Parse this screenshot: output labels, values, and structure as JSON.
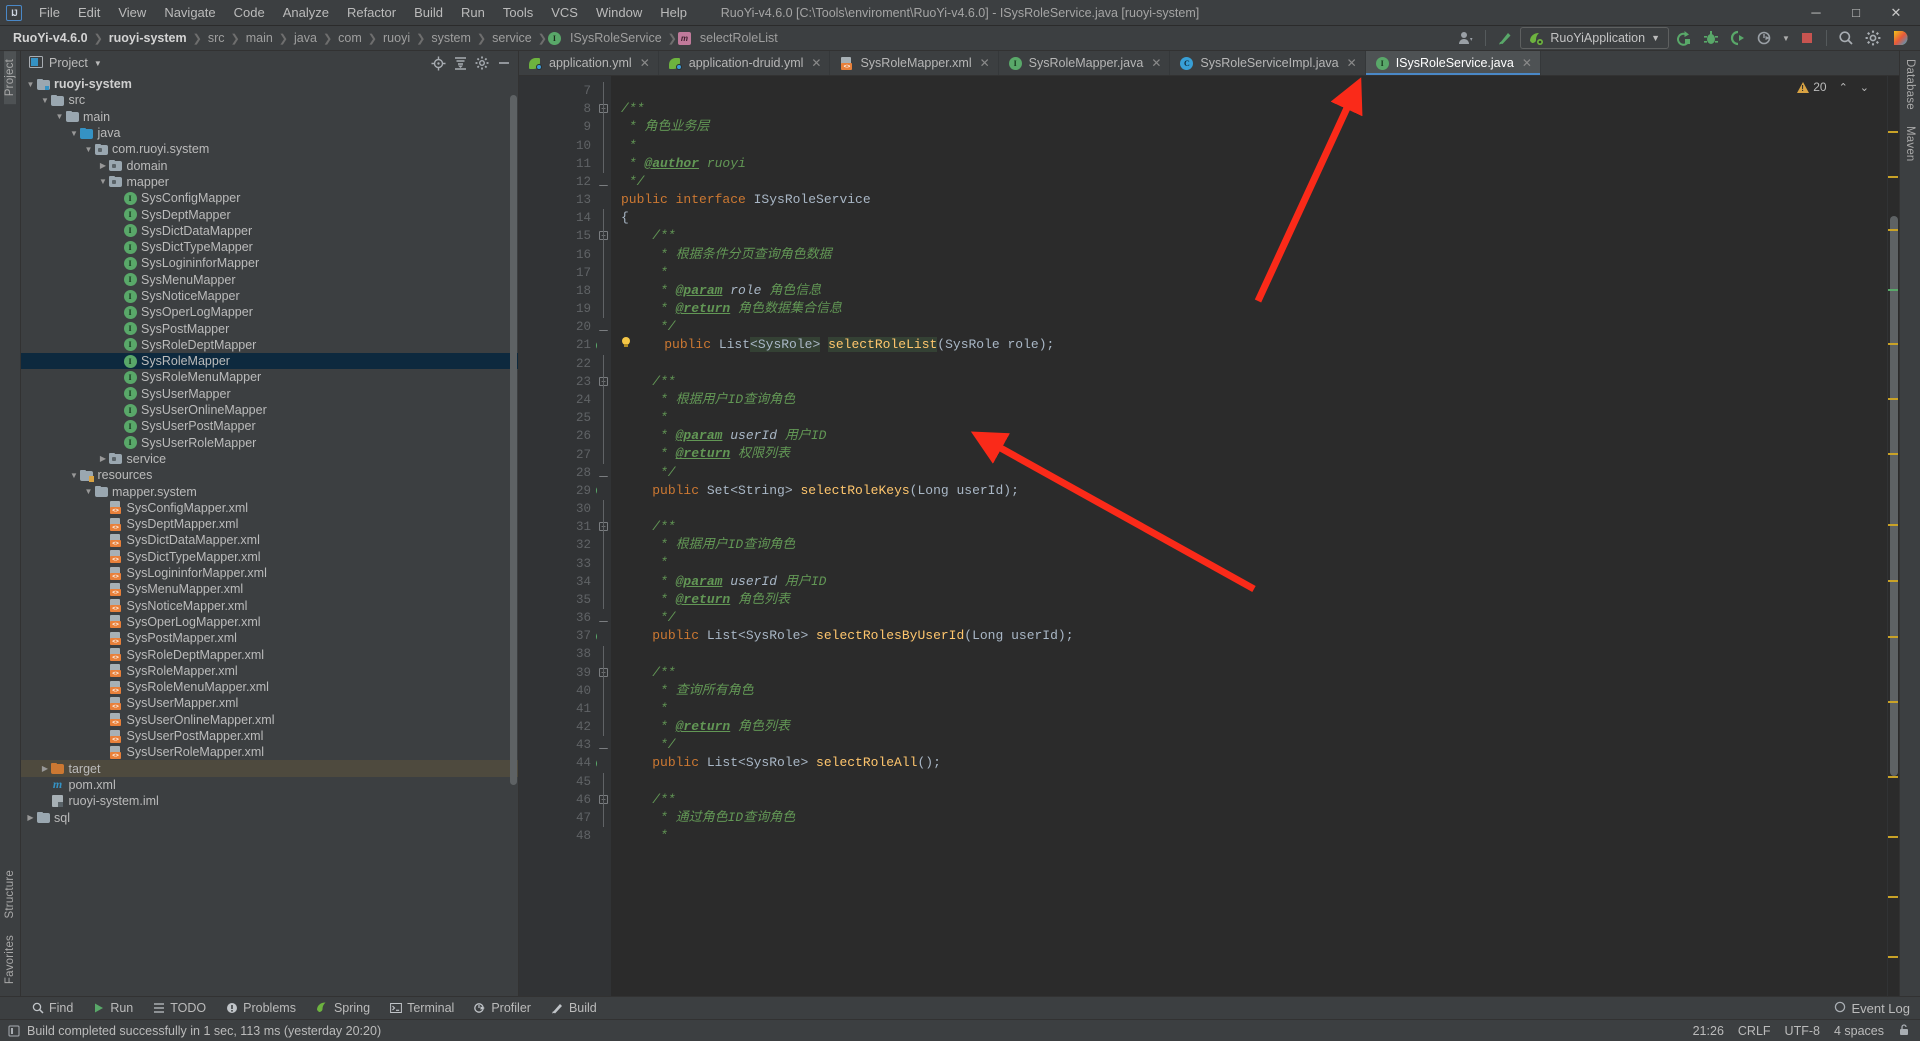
{
  "window": {
    "title": "RuoYi-v4.6.0 [C:\\Tools\\enviroment\\RuoYi-v4.6.0] - ISysRoleService.java [ruoyi-system]",
    "minimize": "─",
    "maximize": "□",
    "close": "✕"
  },
  "menu": [
    {
      "label": "File"
    },
    {
      "label": "Edit"
    },
    {
      "label": "View"
    },
    {
      "label": "Navigate"
    },
    {
      "label": "Code"
    },
    {
      "label": "Analyze"
    },
    {
      "label": "Refactor"
    },
    {
      "label": "Build"
    },
    {
      "label": "Run"
    },
    {
      "label": "Tools"
    },
    {
      "label": "VCS"
    },
    {
      "label": "Window"
    },
    {
      "label": "Help"
    }
  ],
  "breadcrumb": [
    {
      "label": "RuoYi-v4.6.0",
      "bold": true,
      "icon": null
    },
    {
      "label": "ruoyi-system",
      "bold": true,
      "icon": null
    },
    {
      "label": "src",
      "bold": false,
      "icon": null
    },
    {
      "label": "main",
      "bold": false,
      "icon": null
    },
    {
      "label": "java",
      "bold": false,
      "icon": null
    },
    {
      "label": "com",
      "bold": false,
      "icon": null
    },
    {
      "label": "ruoyi",
      "bold": false,
      "icon": null
    },
    {
      "label": "system",
      "bold": false,
      "icon": null
    },
    {
      "label": "service",
      "bold": false,
      "icon": null
    },
    {
      "label": "ISysRoleService",
      "bold": false,
      "icon": "interface-icon"
    },
    {
      "label": "selectRoleList",
      "bold": false,
      "icon": "method-icon"
    }
  ],
  "toolbar": {
    "run_config": "RuoYiApplication",
    "icons": [
      "user-icon",
      "vcs-update-icon",
      "run-icon",
      "debug-icon",
      "run-coverage-icon",
      "profiler-icon",
      "stop-icon",
      "search-everywhere-icon",
      "settings-icon",
      "ide-help-icon"
    ]
  },
  "project_panel": {
    "title": "Project",
    "actions": [
      "locate-icon",
      "collapse-all-icon",
      "settings-icon",
      "hide-icon"
    ],
    "tree": [
      {
        "depth": 1,
        "label": "ruoyi-system",
        "icon": "module-folder",
        "arrow": "down",
        "bold": true
      },
      {
        "depth": 2,
        "label": "src",
        "icon": "folder",
        "arrow": "down"
      },
      {
        "depth": 3,
        "label": "main",
        "icon": "folder",
        "arrow": "down"
      },
      {
        "depth": 4,
        "label": "java",
        "icon": "source-folder",
        "arrow": "down"
      },
      {
        "depth": 5,
        "label": "com.ruoyi.system",
        "icon": "package",
        "arrow": "down"
      },
      {
        "depth": 6,
        "label": "domain",
        "icon": "package",
        "arrow": "right"
      },
      {
        "depth": 6,
        "label": "mapper",
        "icon": "package",
        "arrow": "down"
      },
      {
        "depth": 7,
        "label": "SysConfigMapper",
        "icon": "interface"
      },
      {
        "depth": 7,
        "label": "SysDeptMapper",
        "icon": "interface"
      },
      {
        "depth": 7,
        "label": "SysDictDataMapper",
        "icon": "interface"
      },
      {
        "depth": 7,
        "label": "SysDictTypeMapper",
        "icon": "interface"
      },
      {
        "depth": 7,
        "label": "SysLogininforMapper",
        "icon": "interface"
      },
      {
        "depth": 7,
        "label": "SysMenuMapper",
        "icon": "interface"
      },
      {
        "depth": 7,
        "label": "SysNoticeMapper",
        "icon": "interface"
      },
      {
        "depth": 7,
        "label": "SysOperLogMapper",
        "icon": "interface"
      },
      {
        "depth": 7,
        "label": "SysPostMapper",
        "icon": "interface"
      },
      {
        "depth": 7,
        "label": "SysRoleDeptMapper",
        "icon": "interface"
      },
      {
        "depth": 7,
        "label": "SysRoleMapper",
        "icon": "interface",
        "selected": true
      },
      {
        "depth": 7,
        "label": "SysRoleMenuMapper",
        "icon": "interface"
      },
      {
        "depth": 7,
        "label": "SysUserMapper",
        "icon": "interface"
      },
      {
        "depth": 7,
        "label": "SysUserOnlineMapper",
        "icon": "interface"
      },
      {
        "depth": 7,
        "label": "SysUserPostMapper",
        "icon": "interface"
      },
      {
        "depth": 7,
        "label": "SysUserRoleMapper",
        "icon": "interface"
      },
      {
        "depth": 6,
        "label": "service",
        "icon": "package",
        "arrow": "right"
      },
      {
        "depth": 4,
        "label": "resources",
        "icon": "resource-folder",
        "arrow": "down"
      },
      {
        "depth": 5,
        "label": "mapper.system",
        "icon": "folder",
        "arrow": "down"
      },
      {
        "depth": 6,
        "label": "SysConfigMapper.xml",
        "icon": "xml"
      },
      {
        "depth": 6,
        "label": "SysDeptMapper.xml",
        "icon": "xml"
      },
      {
        "depth": 6,
        "label": "SysDictDataMapper.xml",
        "icon": "xml"
      },
      {
        "depth": 6,
        "label": "SysDictTypeMapper.xml",
        "icon": "xml"
      },
      {
        "depth": 6,
        "label": "SysLogininforMapper.xml",
        "icon": "xml"
      },
      {
        "depth": 6,
        "label": "SysMenuMapper.xml",
        "icon": "xml"
      },
      {
        "depth": 6,
        "label": "SysNoticeMapper.xml",
        "icon": "xml"
      },
      {
        "depth": 6,
        "label": "SysOperLogMapper.xml",
        "icon": "xml"
      },
      {
        "depth": 6,
        "label": "SysPostMapper.xml",
        "icon": "xml"
      },
      {
        "depth": 6,
        "label": "SysRoleDeptMapper.xml",
        "icon": "xml"
      },
      {
        "depth": 6,
        "label": "SysRoleMapper.xml",
        "icon": "xml"
      },
      {
        "depth": 6,
        "label": "SysRoleMenuMapper.xml",
        "icon": "xml"
      },
      {
        "depth": 6,
        "label": "SysUserMapper.xml",
        "icon": "xml"
      },
      {
        "depth": 6,
        "label": "SysUserOnlineMapper.xml",
        "icon": "xml"
      },
      {
        "depth": 6,
        "label": "SysUserPostMapper.xml",
        "icon": "xml"
      },
      {
        "depth": 6,
        "label": "SysUserRoleMapper.xml",
        "icon": "xml"
      },
      {
        "depth": 2,
        "label": "target",
        "icon": "target-folder",
        "arrow": "right",
        "dimselected": true
      },
      {
        "depth": 2,
        "label": "pom.xml",
        "icon": "maven"
      },
      {
        "depth": 2,
        "label": "ruoyi-system.iml",
        "icon": "iml"
      },
      {
        "depth": 1,
        "label": "sql",
        "icon": "folder",
        "arrow": "right"
      }
    ]
  },
  "left_rail": {
    "top": [
      {
        "label": "Project",
        "active": true
      }
    ],
    "bottom": [
      {
        "label": "Structure"
      },
      {
        "label": "Favorites"
      }
    ]
  },
  "right_rail": [
    {
      "label": "Database"
    },
    {
      "label": "Maven"
    }
  ],
  "tabs": [
    {
      "label": "application.yml",
      "icon": "yml",
      "active": false
    },
    {
      "label": "application-druid.yml",
      "icon": "yml",
      "active": false
    },
    {
      "label": "SysRoleMapper.xml",
      "icon": "xml",
      "active": false
    },
    {
      "label": "SysRoleMapper.java",
      "icon": "interface",
      "active": false
    },
    {
      "label": "SysRoleServiceImpl.java",
      "icon": "class",
      "active": false
    },
    {
      "label": "ISysRoleService.java",
      "icon": "interface",
      "active": true
    }
  ],
  "editor": {
    "first_line": 7,
    "inspection_count": "20",
    "lines": [
      {
        "n": 7,
        "segs": []
      },
      {
        "n": 8,
        "fold": "minus",
        "segs": [
          {
            "t": "/**",
            "c": "cmt"
          }
        ]
      },
      {
        "n": 9,
        "segs": [
          {
            "t": " * 角色业务层",
            "c": "cmt"
          }
        ]
      },
      {
        "n": 10,
        "segs": [
          {
            "t": " *",
            "c": "cmt"
          }
        ]
      },
      {
        "n": 11,
        "segs": [
          {
            "t": " * ",
            "c": "cmt"
          },
          {
            "t": "@author",
            "c": "tag-jd"
          },
          {
            "t": " ruoyi",
            "c": "cmt"
          }
        ]
      },
      {
        "n": 12,
        "fold": "end",
        "segs": [
          {
            "t": " */",
            "c": "cmt"
          }
        ]
      },
      {
        "n": 13,
        "gutter": [
          "bean-icon",
          "impl-icon"
        ],
        "segs": [
          {
            "t": "public interface ",
            "c": "kw"
          },
          {
            "t": "ISysRoleService",
            "c": "plain"
          }
        ]
      },
      {
        "n": 14,
        "segs": [
          {
            "t": "{",
            "c": "plain"
          }
        ]
      },
      {
        "n": 15,
        "fold": "minus",
        "segs": [
          {
            "t": "    /**",
            "c": "cmt"
          }
        ]
      },
      {
        "n": 16,
        "segs": [
          {
            "t": "     * 根据条件分页查询角色数据",
            "c": "cmt"
          }
        ]
      },
      {
        "n": 17,
        "segs": [
          {
            "t": "     *",
            "c": "cmt"
          }
        ]
      },
      {
        "n": 18,
        "segs": [
          {
            "t": "     * ",
            "c": "cmt"
          },
          {
            "t": "@param",
            "c": "tag-jd"
          },
          {
            "t": " role",
            "c": "jd-param"
          },
          {
            "t": " 角色信息",
            "c": "cmt"
          }
        ]
      },
      {
        "n": 19,
        "segs": [
          {
            "t": "     * ",
            "c": "cmt"
          },
          {
            "t": "@return",
            "c": "tag-jd"
          },
          {
            "t": " 角色数据集合信息",
            "c": "cmt"
          }
        ]
      },
      {
        "n": 20,
        "fold": "end",
        "segs": [
          {
            "t": "     */",
            "c": "cmt"
          }
        ]
      },
      {
        "n": 21,
        "gutter": [
          "impl-icon"
        ],
        "bulb": true,
        "segs": [
          {
            "t": "    ",
            "c": "plain"
          },
          {
            "t": "public ",
            "c": "kw"
          },
          {
            "t": "List",
            "c": "plain"
          },
          {
            "t": "<SysRole>",
            "c": "plain hl"
          },
          {
            "t": " ",
            "c": "plain"
          },
          {
            "t": "selectRoleList",
            "c": "mth hl"
          },
          {
            "t": "(SysRole role);",
            "c": "plain"
          }
        ]
      },
      {
        "n": 22,
        "segs": []
      },
      {
        "n": 23,
        "fold": "minus",
        "segs": [
          {
            "t": "    /**",
            "c": "cmt"
          }
        ]
      },
      {
        "n": 24,
        "segs": [
          {
            "t": "     * 根据用户ID查询角色",
            "c": "cmt"
          }
        ]
      },
      {
        "n": 25,
        "segs": [
          {
            "t": "     *",
            "c": "cmt"
          }
        ]
      },
      {
        "n": 26,
        "segs": [
          {
            "t": "     * ",
            "c": "cmt"
          },
          {
            "t": "@param",
            "c": "tag-jd"
          },
          {
            "t": " userId",
            "c": "jd-param"
          },
          {
            "t": " 用户ID",
            "c": "cmt"
          }
        ]
      },
      {
        "n": 27,
        "segs": [
          {
            "t": "     * ",
            "c": "cmt"
          },
          {
            "t": "@return",
            "c": "tag-jd"
          },
          {
            "t": " 权限列表",
            "c": "cmt"
          }
        ]
      },
      {
        "n": 28,
        "fold": "end",
        "segs": [
          {
            "t": "     */",
            "c": "cmt"
          }
        ]
      },
      {
        "n": 29,
        "gutter": [
          "impl-icon"
        ],
        "segs": [
          {
            "t": "    ",
            "c": "plain"
          },
          {
            "t": "public ",
            "c": "kw"
          },
          {
            "t": "Set<String> ",
            "c": "plain"
          },
          {
            "t": "selectRoleKeys",
            "c": "mth"
          },
          {
            "t": "(Long userId);",
            "c": "plain"
          }
        ]
      },
      {
        "n": 30,
        "segs": []
      },
      {
        "n": 31,
        "fold": "minus",
        "segs": [
          {
            "t": "    /**",
            "c": "cmt"
          }
        ]
      },
      {
        "n": 32,
        "segs": [
          {
            "t": "     * 根据用户ID查询角色",
            "c": "cmt"
          }
        ]
      },
      {
        "n": 33,
        "segs": [
          {
            "t": "     *",
            "c": "cmt"
          }
        ]
      },
      {
        "n": 34,
        "segs": [
          {
            "t": "     * ",
            "c": "cmt"
          },
          {
            "t": "@param",
            "c": "tag-jd"
          },
          {
            "t": " userId",
            "c": "jd-param"
          },
          {
            "t": " 用户ID",
            "c": "cmt"
          }
        ]
      },
      {
        "n": 35,
        "segs": [
          {
            "t": "     * ",
            "c": "cmt"
          },
          {
            "t": "@return",
            "c": "tag-jd"
          },
          {
            "t": " 角色列表",
            "c": "cmt"
          }
        ]
      },
      {
        "n": 36,
        "fold": "end",
        "segs": [
          {
            "t": "     */",
            "c": "cmt"
          }
        ]
      },
      {
        "n": 37,
        "gutter": [
          "impl-icon"
        ],
        "segs": [
          {
            "t": "    ",
            "c": "plain"
          },
          {
            "t": "public ",
            "c": "kw"
          },
          {
            "t": "List<SysRole> ",
            "c": "plain"
          },
          {
            "t": "selectRolesByUserId",
            "c": "mth"
          },
          {
            "t": "(Long userId);",
            "c": "plain"
          }
        ]
      },
      {
        "n": 38,
        "segs": []
      },
      {
        "n": 39,
        "fold": "minus",
        "segs": [
          {
            "t": "    /**",
            "c": "cmt"
          }
        ]
      },
      {
        "n": 40,
        "segs": [
          {
            "t": "     * 查询所有角色",
            "c": "cmt"
          }
        ]
      },
      {
        "n": 41,
        "segs": [
          {
            "t": "     *",
            "c": "cmt"
          }
        ]
      },
      {
        "n": 42,
        "segs": [
          {
            "t": "     * ",
            "c": "cmt"
          },
          {
            "t": "@return",
            "c": "tag-jd"
          },
          {
            "t": " 角色列表",
            "c": "cmt"
          }
        ]
      },
      {
        "n": 43,
        "fold": "end",
        "segs": [
          {
            "t": "     */",
            "c": "cmt"
          }
        ]
      },
      {
        "n": 44,
        "gutter": [
          "impl-icon"
        ],
        "segs": [
          {
            "t": "    ",
            "c": "plain"
          },
          {
            "t": "public ",
            "c": "kw"
          },
          {
            "t": "List<SysRole> ",
            "c": "plain"
          },
          {
            "t": "selectRoleAll",
            "c": "mth"
          },
          {
            "t": "();",
            "c": "plain"
          }
        ]
      },
      {
        "n": 45,
        "segs": []
      },
      {
        "n": 46,
        "fold": "minus",
        "segs": [
          {
            "t": "    /**",
            "c": "cmt"
          }
        ]
      },
      {
        "n": 47,
        "segs": [
          {
            "t": "     * 通过角色ID查询角色",
            "c": "cmt"
          }
        ]
      },
      {
        "n": 48,
        "segs": [
          {
            "t": "     *",
            "c": "cmt"
          }
        ]
      }
    ]
  },
  "tool_windows": [
    {
      "label": "Find",
      "icon": "search-icon"
    },
    {
      "label": "Run",
      "icon": "run-icon"
    },
    {
      "label": "TODO",
      "icon": "todo-icon"
    },
    {
      "label": "Problems",
      "icon": "problems-icon"
    },
    {
      "label": "Spring",
      "icon": "spring-icon"
    },
    {
      "label": "Terminal",
      "icon": "terminal-icon"
    },
    {
      "label": "Profiler",
      "icon": "profiler-icon"
    },
    {
      "label": "Build",
      "icon": "build-icon"
    }
  ],
  "event_log": "Event Log",
  "status": {
    "message": "Build completed successfully in 1 sec, 113 ms (yesterday 20:20)",
    "time": "21:26",
    "line_sep": "CRLF",
    "encoding": "UTF-8",
    "indent": "4 spaces",
    "lock": "lock-icon"
  },
  "annotations": {
    "arrow_color": "#fa2a19"
  }
}
